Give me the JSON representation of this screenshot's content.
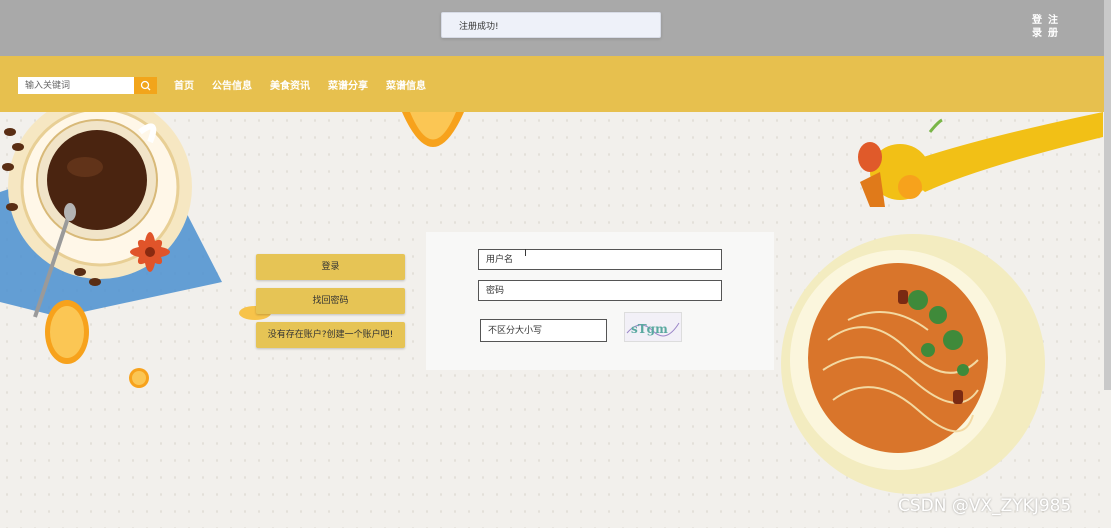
{
  "toast": {
    "message": "注册成功!"
  },
  "auth": {
    "login": "登\n录",
    "register": "注\n册"
  },
  "search": {
    "placeholder": "输入关键词"
  },
  "nav": {
    "items": [
      {
        "label": "首页"
      },
      {
        "label": "公告信息"
      },
      {
        "label": "美食资讯"
      },
      {
        "label": "菜谱分享"
      },
      {
        "label": "菜谱信息"
      }
    ]
  },
  "side": {
    "login_label": "登录",
    "forgot_label": "找回密码",
    "register_label": "没有存在账户?创建一个账户吧!"
  },
  "form": {
    "username_placeholder": "用户名",
    "password_placeholder": "密码",
    "captcha_placeholder": "不区分大小写",
    "captcha_text": "sTgm"
  },
  "watermark": "CSDN @VX_ZYKJ985",
  "colors": {
    "navbar": "#e7c04e",
    "topbar": "#a9a9a9",
    "search_button": "#f2a51b",
    "side_button": "#e6c455"
  }
}
